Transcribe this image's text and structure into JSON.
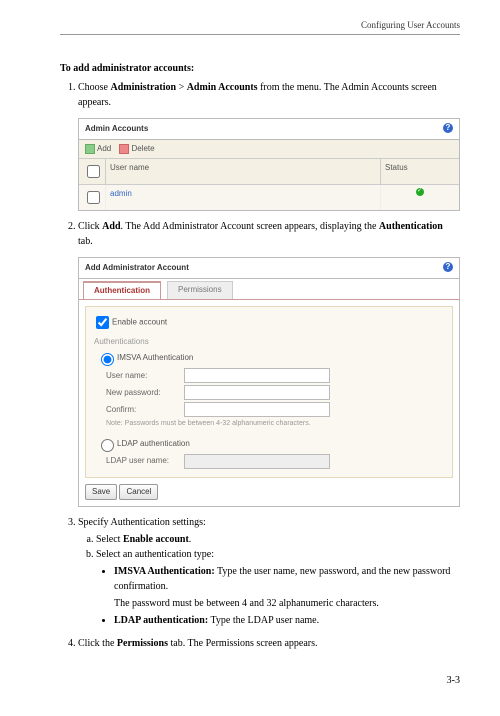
{
  "header": {
    "title": "Configuring User Accounts"
  },
  "section": {
    "title": "To add administrator accounts:"
  },
  "steps": {
    "s1": {
      "prefix": "Choose ",
      "b1": "Administration",
      "sep": " > ",
      "b2": "Admin Accounts",
      "suffix": " from the menu. The Admin Accounts screen appears."
    },
    "s2": {
      "prefix": "Click ",
      "b1": "Add",
      "mid": ". The Add Administrator Account screen appears, displaying the ",
      "b2": "Authentication",
      "suffix": " tab."
    },
    "s3": {
      "text": "Specify Authentication settings:"
    },
    "s3a": {
      "prefix": "Select ",
      "b1": "Enable account",
      "suffix": "."
    },
    "s3b": {
      "text": "Select an authentication type:"
    },
    "s3b1": {
      "b": "IMSVA Authentication:",
      "text": " Type the user name, new password, and the new password confirmation.",
      "note": "The password must be between 4 and 32 alphanumeric characters."
    },
    "s3b2": {
      "b": "LDAP authentication:",
      "text": " Type the LDAP user name."
    },
    "s4": {
      "prefix": "Click the ",
      "b": "Permissions",
      "suffix": " tab. The Permissions screen appears."
    }
  },
  "shot1": {
    "title": "Admin Accounts",
    "toolbar": {
      "add": "Add",
      "delete": "Delete"
    },
    "cols": {
      "user": "User name",
      "status": "Status"
    },
    "row": {
      "user": "admin"
    }
  },
  "shot2": {
    "title": "Add Administrator Account",
    "tabs": {
      "auth": "Authentication",
      "perm": "Permissions"
    },
    "enable": "Enable account",
    "auth_header": "Authentications",
    "radio_imsva": "IMSVA Authentication",
    "fields": {
      "user": "User name:",
      "newpw": "New password:",
      "confirm": "Confirm:"
    },
    "note": "Note: Passwords must be between 4-32 alphanumeric characters.",
    "radio_ldap": "LDAP authentication",
    "ldap_label": "LDAP user name:",
    "save": "Save",
    "cancel": "Cancel"
  },
  "page_number": "3-3"
}
